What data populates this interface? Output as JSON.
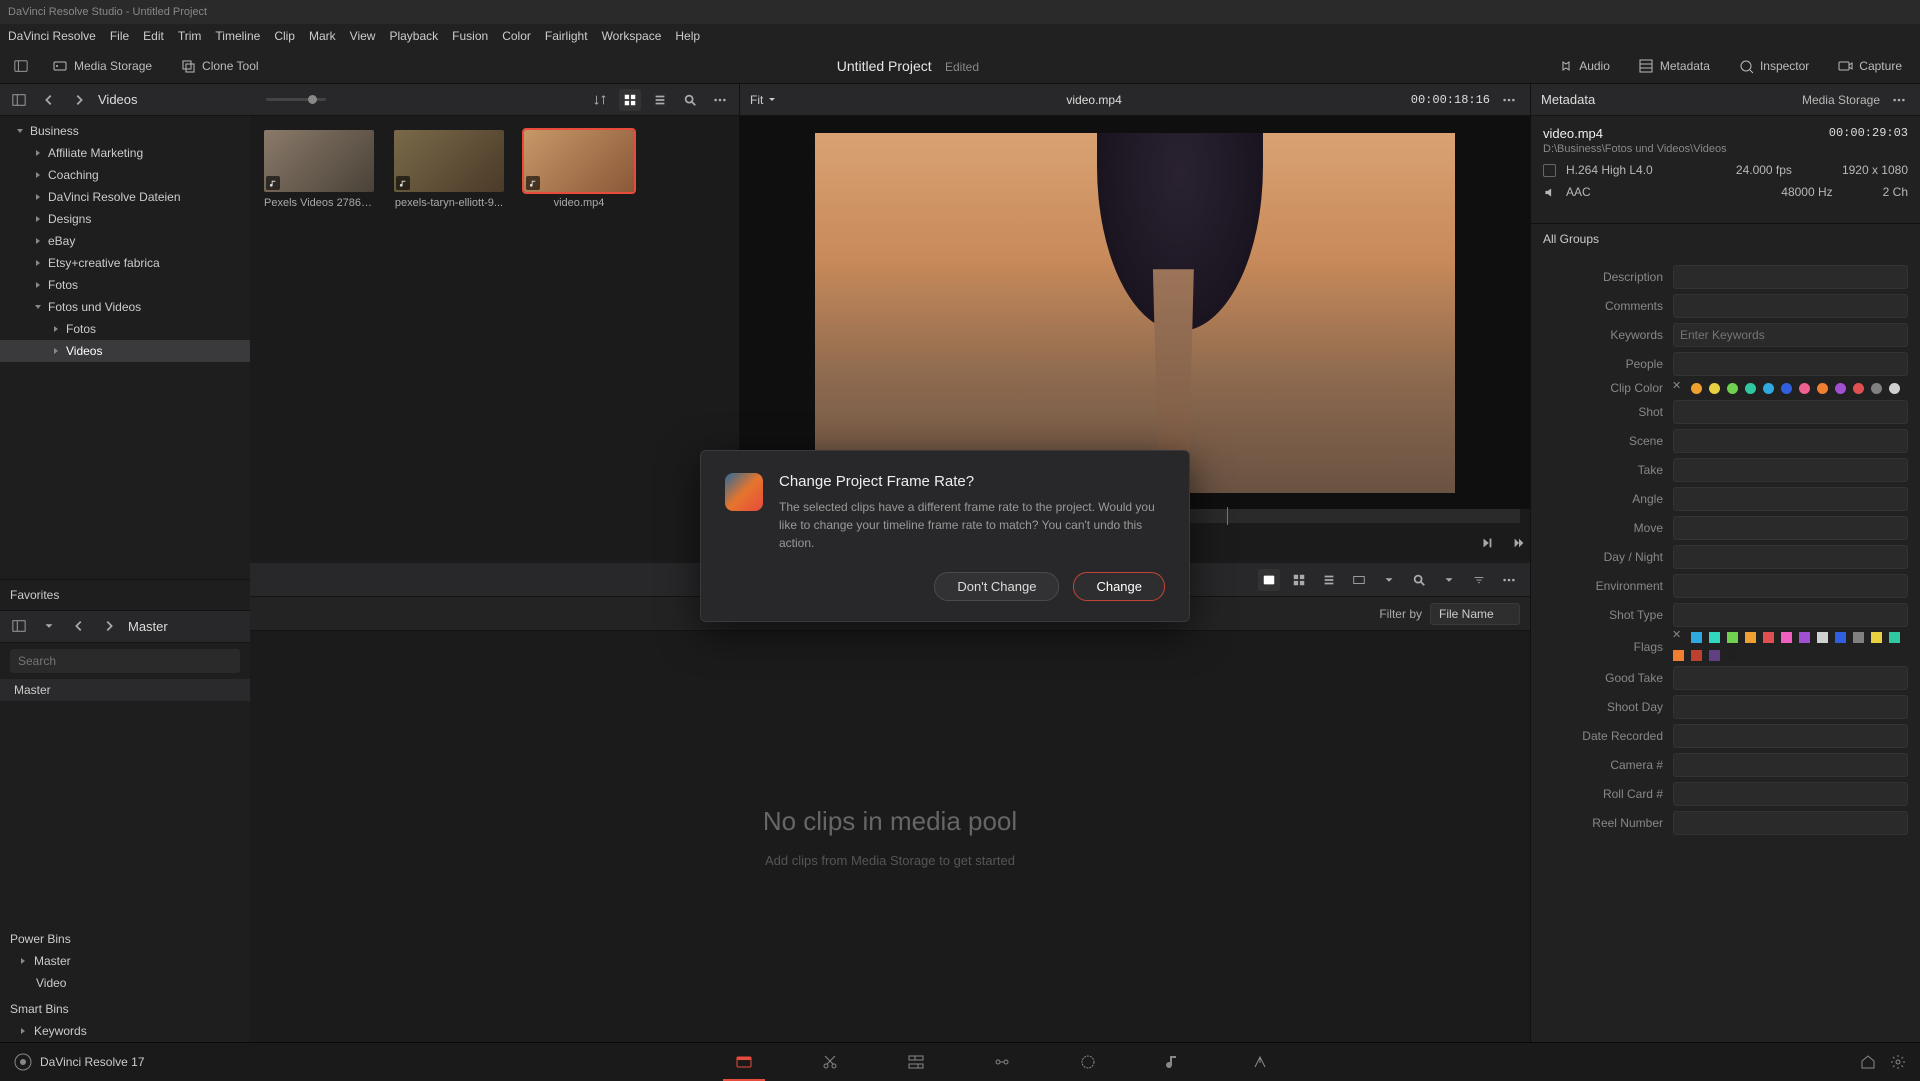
{
  "titlebar": "DaVinci Resolve Studio - Untitled Project",
  "menu": [
    "DaVinci Resolve",
    "File",
    "Edit",
    "Trim",
    "Timeline",
    "Clip",
    "Mark",
    "View",
    "Playback",
    "Fusion",
    "Color",
    "Fairlight",
    "Workspace",
    "Help"
  ],
  "toolbar": {
    "mediaStorage": "Media Storage",
    "cloneTool": "Clone Tool",
    "projectTitle": "Untitled Project",
    "projectStatus": "Edited",
    "audio": "Audio",
    "metadata": "Metadata",
    "inspector": "Inspector",
    "capture": "Capture"
  },
  "mediaTree": {
    "header": "Videos",
    "items": [
      {
        "label": "Business",
        "depth": 0,
        "open": true
      },
      {
        "label": "Affiliate Marketing",
        "depth": 1
      },
      {
        "label": "Coaching",
        "depth": 1
      },
      {
        "label": "DaVinci Resolve Dateien",
        "depth": 1
      },
      {
        "label": "Designs",
        "depth": 1
      },
      {
        "label": "eBay",
        "depth": 1
      },
      {
        "label": "Etsy+creative fabrica",
        "depth": 1
      },
      {
        "label": "Fotos",
        "depth": 1
      },
      {
        "label": "Fotos und Videos",
        "depth": 1,
        "open": true
      },
      {
        "label": "Fotos",
        "depth": 2
      },
      {
        "label": "Videos",
        "depth": 2,
        "selected": true
      }
    ],
    "favorites": "Favorites"
  },
  "thumbs": [
    {
      "label": "Pexels Videos 2786S..."
    },
    {
      "label": "pexels-taryn-elliott-9..."
    },
    {
      "label": "video.mp4",
      "selected": true
    }
  ],
  "viewer": {
    "fit": "Fit",
    "clip": "video.mp4",
    "tc": "00:00:18:16"
  },
  "master": {
    "header": "Master",
    "searchPlaceholder": "Search",
    "root": "Master",
    "powerBins": "Power Bins",
    "powerMaster": "Master",
    "powerVideo": "Video",
    "smartBins": "Smart Bins",
    "keywords": "Keywords"
  },
  "pool": {
    "filterBy": "Filter by",
    "filterValue": "File Name",
    "emptyTitle": "No clips in media pool",
    "emptySub": "Add clips from Media Storage to get started"
  },
  "metadata": {
    "header": "Metadata",
    "headerRight": "Media Storage",
    "filename": "video.mp4",
    "path": "D:\\Business\\Fotos und Videos\\Videos",
    "duration": "00:00:29:03",
    "codec": "H.264 High L4.0",
    "fps": "24.000 fps",
    "res": "1920 x 1080",
    "audioCodec": "AAC",
    "audioRate": "48000 Hz",
    "audioCh": "2 Ch",
    "allGroups": "All Groups",
    "fields": [
      "Description",
      "Comments",
      "Keywords",
      "People",
      "Clip Color",
      "Shot",
      "Scene",
      "Take",
      "Angle",
      "Move",
      "Day / Night",
      "Environment",
      "Shot Type",
      "Flags",
      "Good Take",
      "Shoot Day",
      "Date Recorded",
      "Camera #",
      "Roll Card #",
      "Reel Number"
    ],
    "keywordsPlaceholder": "Enter Keywords",
    "clipColors": [
      "#f0a030",
      "#e8d040",
      "#70d050",
      "#30c8a0",
      "#30a8e0",
      "#3060e0",
      "#f06090",
      "#f08030",
      "#a050d0",
      "#e05050",
      "#808080",
      "#d0d0d0"
    ],
    "flagColors": [
      "#30a8e0",
      "#30d8c0",
      "#70d050",
      "#f0a030",
      "#e05050",
      "#f060c0",
      "#a050d0",
      "#d0d0d0",
      "#3060e0",
      "#808080",
      "#e8d040",
      "#30c8a0",
      "#f08030",
      "#c04030",
      "#604080",
      "#202020"
    ]
  },
  "dialog": {
    "title": "Change Project Frame Rate?",
    "body": "The selected clips have a different frame rate to the project. Would you like to change your timeline frame rate to match? You can't undo this action.",
    "dontChange": "Don't Change",
    "change": "Change"
  },
  "bottom": {
    "appName": "DaVinci Resolve 17"
  }
}
